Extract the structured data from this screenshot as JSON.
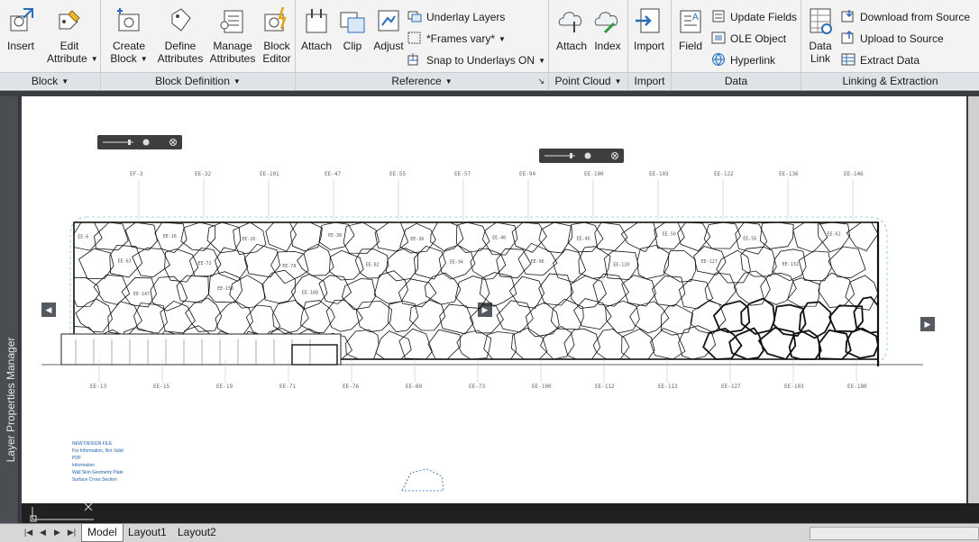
{
  "ribbon": {
    "panels": {
      "block": "Block",
      "block_definition": "Block Definition",
      "reference": "Reference",
      "point_cloud": "Point Cloud",
      "import": "Import",
      "data": "Data",
      "linking": "Linking & Extraction"
    },
    "buttons": {
      "insert": "Insert",
      "edit_attribute": [
        "Edit",
        "Attribute"
      ],
      "create_block": [
        "Create",
        "Block"
      ],
      "define_attributes": [
        "Define",
        "Attributes"
      ],
      "manage_attributes": [
        "Manage",
        "Attributes"
      ],
      "block_editor": [
        "Block",
        "Editor"
      ],
      "attach": "Attach",
      "clip": "Clip",
      "adjust": "Adjust",
      "underlay_layers": "Underlay Layers",
      "frames_vary": "*Frames vary*",
      "snap_underlays": "Snap to Underlays ON",
      "pc_attach": "Attach",
      "pc_index": "Index",
      "import": "Import",
      "field": "Field",
      "update_fields": "Update Fields",
      "ole_object": "OLE Object",
      "hyperlink": "Hyperlink",
      "data_link": [
        "Data",
        "Link"
      ],
      "download_from_source": "Download from Source",
      "upload_to_source": "Upload to Source",
      "extract_data": "Extract  Data"
    }
  },
  "palette_title": "Layer Properties Manager",
  "tabs": [
    "Model",
    "Layout1",
    "Layout2"
  ],
  "drawing": {
    "top_tags": [
      "EF-3",
      "EE-32",
      "EE-101",
      "EE-47",
      "EE-55",
      "EE-57",
      "EE-94",
      "EE-100",
      "EE-103",
      "EE-122",
      "EE-136",
      "EE-146"
    ],
    "bottom_tags": [
      "EE-13",
      "EE-15",
      "EE-19",
      "EE-71",
      "EE-76",
      "EE-80",
      "EE-73",
      "EE-100",
      "EE-112",
      "EE-113",
      "EE-127",
      "EE-103",
      "EE-180"
    ],
    "cell_tags": [
      "EE-6",
      "EE-16",
      "EE-26",
      "EE-30",
      "EE-36",
      "EE-40",
      "EE-46",
      "EE-50",
      "EE-56",
      "EE-62",
      "EE-63",
      "EE-72",
      "EE-78",
      "EE-82",
      "EE-94",
      "EE-96",
      "EE-120",
      "EE-127",
      "EE-132",
      "EE-147",
      "EE-150",
      "EE-168"
    ],
    "legend": [
      "NEW DESIGN FILE",
      "For Information, Not Valid",
      "PDF",
      "Information",
      "Wall Skin Geometry Plate",
      "Surface Cross Section"
    ]
  },
  "colors": {
    "ribbon_bg": "#f3f3f3",
    "panel_title_bg": "#dfe3e8",
    "drawing_bg": "#3a3d41",
    "sheet_bg": "#ffffff",
    "cell_stroke": "#111111",
    "legend_blue": "#1f5fb0"
  },
  "icons": [
    "insert-icon",
    "edit-attribute-icon",
    "create-block-icon",
    "define-attributes-icon",
    "manage-attributes-icon",
    "block-editor-icon",
    "attach-icon",
    "clip-icon",
    "adjust-icon",
    "underlay-layers-icon",
    "frames-icon",
    "snap-icon",
    "point-cloud-attach-icon",
    "point-cloud-index-icon",
    "import-icon",
    "field-icon",
    "update-fields-icon",
    "ole-object-icon",
    "hyperlink-icon",
    "data-link-icon",
    "download-icon",
    "upload-icon",
    "extract-data-icon"
  ]
}
